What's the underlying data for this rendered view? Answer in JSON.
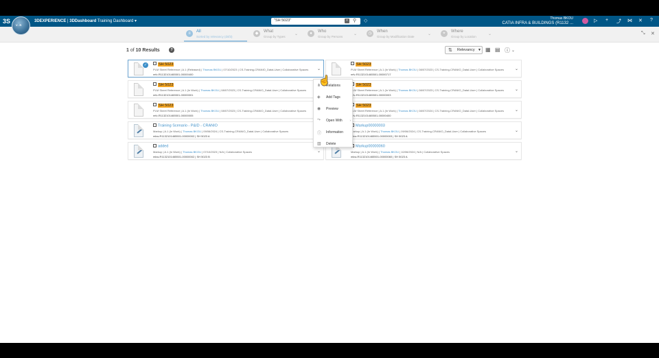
{
  "topbar": {
    "logo": "3S",
    "compass_text": "V.R",
    "brand": "3DEXPERIENCE",
    "app": "3DDashboard",
    "dashboard": "Training Dashboard",
    "search_value": "\"SH 5023\"",
    "user": "Thomas BKOU",
    "workspace": "CATIA INFRA & BUILDINGS (R1132 ...",
    "icons": [
      "plus-icon",
      "share-icon",
      "tools-icon",
      "help-icon"
    ]
  },
  "filters": [
    {
      "label": "All",
      "sub": "Sorted by relevancy (dsf3)"
    },
    {
      "label": "What",
      "sub": "Group by Types"
    },
    {
      "label": "Who",
      "sub": "Group by Persons"
    },
    {
      "label": "When",
      "sub": "Group by Modification Date"
    },
    {
      "label": "Where",
      "sub": "Group by Location"
    }
  ],
  "results": {
    "page": "1",
    "of": "of",
    "total": "10",
    "label": "Results",
    "sort": "Relevancy"
  },
  "cards": [
    {
      "title": "SH 5023",
      "meta_a": "PLM Sheet Reference | A.1 (Released) | ",
      "owner": "Thomas BKOU",
      "meta_b": " | 07/10/2023 | CS-Training-CRANIO_Datal-User | Collaborative Spaces",
      "id": "mfv-R1132101465501-00000400"
    },
    {
      "title": "SH 5023",
      "meta_a": "PLM Sheet Reference | A.1 (In Work) | ",
      "owner": "Thomas BKOU",
      "meta_b": " | 08/07/2023 | CS-Training-CRANIO_Datal-User | Collaborative Spaces",
      "id": "mfv-R1132101465501-00000717"
    },
    {
      "title": "SH 5023",
      "meta_a": "PLM Sheet Reference | A.1 (In Work) | ",
      "owner": "Thomas BKOU",
      "meta_b": " | 08/07/2023 | CS-Training-CRANIO_Datal-User | Collaborative Spaces",
      "id": "mfv-R1132101465501-00000001"
    },
    {
      "title": "SH 5023",
      "meta_a": "PLM Sheet Reference | A.1 (In Work) | ",
      "owner": "Thomas BKOU",
      "meta_b": " | 08/07/2023 | CS-Training-CRANIO_Datal-User | Collaborative Spaces",
      "id": "mfv-R1132101465501-00000003"
    },
    {
      "title": "SH 5023",
      "meta_a": "PLM Sheet Reference | A.1 (In Work) | ",
      "owner": "Thomas BKOU",
      "meta_b": " | 08/07/2023 | CS-Training-CRANIO_Datal-User | Collaborative Spaces",
      "id": "mfv-R1132101465501-00000005"
    },
    {
      "title": "SH 5023",
      "meta_a": "PLM Sheet Reference | A.1 (In Work) | ",
      "owner": "Thomas BKOU",
      "meta_b": " | 08/07/2024 | CS-Training-CRANIO_Datal-User | Collaborative Spaces",
      "id": "mfv-R1132101465501-00000400"
    },
    {
      "title": "Training Scenario - P&ID - CRANIO",
      "meta_a": "Markup | A.1 (In Work) | ",
      "owner": "Thomas BKOU",
      "meta_b": " | 09/06/2024 | CS-Training-CRANIO_Datal-User | Collaborative Spaces",
      "id": "mkw-R1132101465501-00000002 | SH 5023 A"
    },
    {
      "title": "Markup00000003",
      "meta_a": "Markup | A.1 (In Work) | ",
      "owner": "Thomas BKOU",
      "meta_b": " | 09/06/2024 | CS-Training-CRANIO_Datal-User | Collaborative Spaces",
      "id": "mkw-R1132101465501-00000003 | SH 5023 A"
    },
    {
      "title": "added",
      "meta_a": "Markup | A.1 (In Work) | ",
      "owner": "Thomas BKOU",
      "meta_b": " | 07/10/2023 | N/A | Collaborative Spaces",
      "id": "mkw-R1132101465501-00000002 | SH 5023 B"
    },
    {
      "title": "Markup00000060",
      "meta_a": "Markup | A.1 (In Work) | ",
      "owner": "Thomas BKOU",
      "meta_b": " | 10/06/2024 | N/A | Collaborative Spaces",
      "id": "mkw-R1132101465501-00000060 | SH 5023 A"
    }
  ],
  "context_menu": [
    {
      "label": "Relations"
    },
    {
      "label": "Add Tags"
    },
    {
      "label": "Preview"
    },
    {
      "label": "Open With"
    },
    {
      "label": "Information"
    },
    {
      "label": "Delete"
    }
  ]
}
